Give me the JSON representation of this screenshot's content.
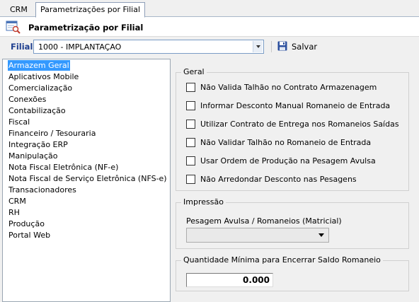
{
  "tabs": [
    {
      "label": "CRM",
      "active": false
    },
    {
      "label": "Parametrizações por Filial",
      "active": true
    }
  ],
  "page_title": "Parametrização por Filial",
  "filial": {
    "label": "Filial",
    "value": "1000 - IMPLANTAÇAO"
  },
  "toolbar": {
    "save_label": "Salvar"
  },
  "left_list": {
    "selected": "Armazem Geral",
    "items": [
      "Armazem Geral",
      "Aplicativos Mobile",
      "Comercialização",
      "Conexões",
      "Contabilização",
      "Fiscal",
      "Financeiro / Tesouraria",
      "Integração ERP",
      "Manipulação",
      "Nota Fiscal Eletrônica (NF-e)",
      "Nota Fiscal de Serviço Eletrônica (NFS-e)",
      "Transacionadores",
      "CRM",
      "RH",
      "Produção",
      "Portal Web"
    ]
  },
  "geral": {
    "title": "Geral",
    "options": [
      {
        "label": "Não Valida Talhão no Contrato Armazenagem",
        "checked": false
      },
      {
        "label": "Informar Desconto Manual Romaneio de Entrada",
        "checked": false
      },
      {
        "label": "Utilizar Contrato de Entrega nos Romaneios Saídas",
        "checked": false
      },
      {
        "label": "Não Validar Talhão no Romaneio de Entrada",
        "checked": false
      },
      {
        "label": "Usar Ordem de Produção na Pesagem Avulsa",
        "checked": false
      },
      {
        "label": "Não Arredondar Desconto nas Pesagens",
        "checked": false
      }
    ]
  },
  "impressao": {
    "title": "Impressão",
    "field_label": "Pesagem Avulsa / Romaneios (Matricial)",
    "value": ""
  },
  "quantidade": {
    "title": "Quantidade Mínima para Encerrar Saldo Romaneio",
    "value": "0.000"
  },
  "colors": {
    "selection": "#3399ff",
    "filial_label": "#1f3f8f",
    "save_icon": "#2b4f9e"
  },
  "icons": {
    "page": "report-search-icon",
    "save": "floppy-disk-icon",
    "dropdown": "chevron-down-icon"
  }
}
